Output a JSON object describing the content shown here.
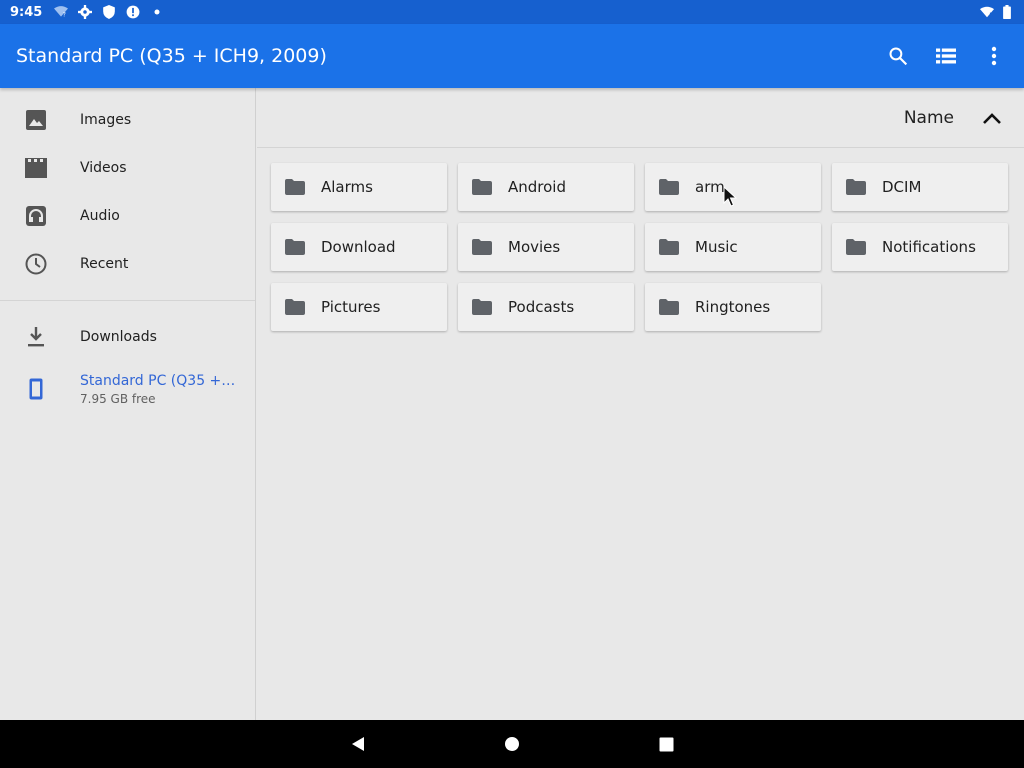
{
  "status_bar": {
    "time": "9:45",
    "icons_left": [
      "wifi-question-icon",
      "settings-icon",
      "shield-icon",
      "alert-icon",
      "dot-icon"
    ],
    "icons_right": [
      "wifi-icon",
      "battery-icon"
    ]
  },
  "app_bar": {
    "title": "Standard PC (Q35 + ICH9, 2009)",
    "actions": [
      "search-icon",
      "list-view-icon",
      "more-vert-icon"
    ]
  },
  "sidebar": {
    "items": [
      {
        "label": "Images",
        "icon": "image-icon"
      },
      {
        "label": "Videos",
        "icon": "video-icon"
      },
      {
        "label": "Audio",
        "icon": "headphones-icon"
      },
      {
        "label": "Recent",
        "icon": "clock-icon"
      }
    ],
    "downloads": {
      "label": "Downloads",
      "icon": "download-icon"
    },
    "root": {
      "title": "Standard PC (Q35 +…",
      "subtitle": "7.95 GB free",
      "icon": "phone-icon"
    }
  },
  "main": {
    "sort_label": "Name",
    "sort_icon": "chevron-up-icon",
    "folders": [
      "Alarms",
      "Android",
      "arm",
      "DCIM",
      "Download",
      "Movies",
      "Music",
      "Notifications",
      "Pictures",
      "Podcasts",
      "Ringtones"
    ]
  },
  "colors": {
    "status_bar": "#1660cf",
    "app_bar": "#1b72e8",
    "accent": "#3367d6"
  }
}
